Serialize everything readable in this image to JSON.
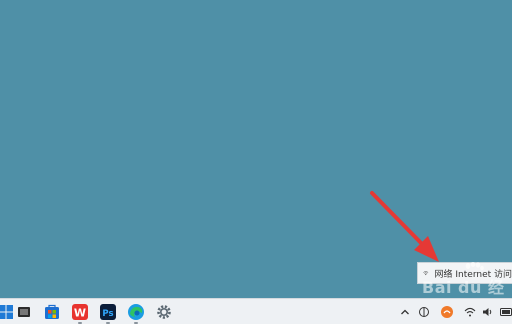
{
  "desktop": {
    "background": "#4f90a7"
  },
  "tooltip": {
    "text": "网络 Internet 访问",
    "icon": "network-icon"
  },
  "watermark": {
    "text": "Bai du 经验"
  },
  "annotation": {
    "type": "red-arrow",
    "color": "#e53935"
  },
  "taskbar": {
    "apps": [
      {
        "name": "start-menu-icon"
      },
      {
        "name": "task-view-icon"
      },
      {
        "name": "microsoft-store-icon"
      },
      {
        "name": "wps-office-icon",
        "label": "W"
      },
      {
        "name": "photoshop-icon",
        "label": "Ps"
      },
      {
        "name": "edge-browser-icon"
      },
      {
        "name": "settings-gear-icon"
      }
    ],
    "tray": [
      "chevron-up-icon",
      "input-method-icon",
      "weather-app-icon",
      "wifi-icon",
      "volume-icon",
      "battery-icon"
    ]
  }
}
